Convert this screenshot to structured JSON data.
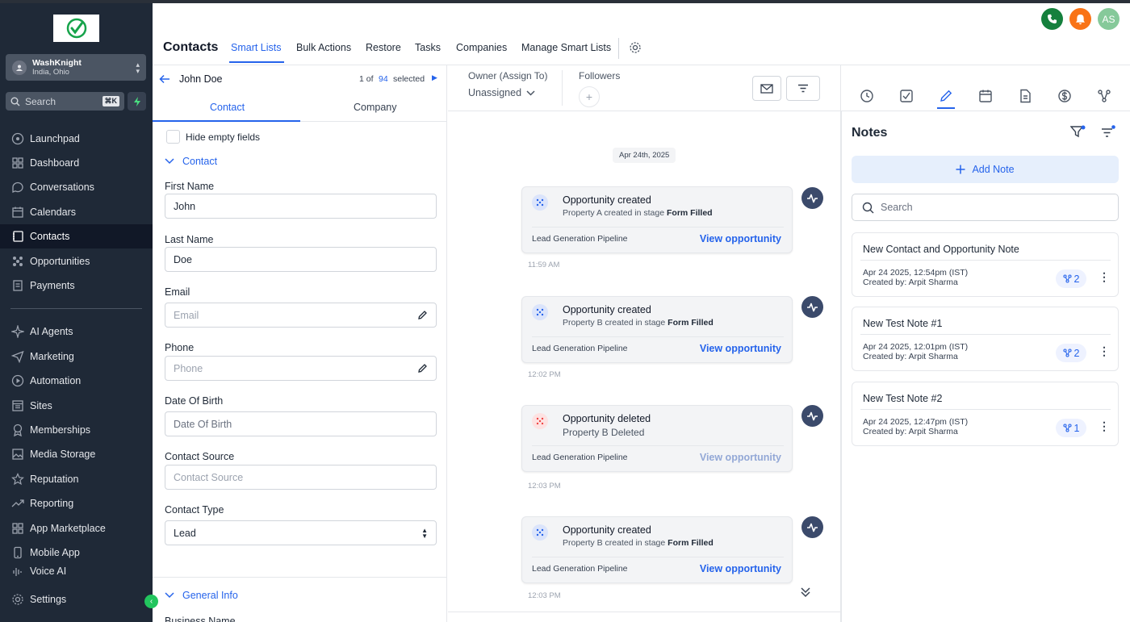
{
  "sidebar": {
    "account": {
      "name": "WashKnight",
      "location": "India, Ohio"
    },
    "search": {
      "placeholder": "Search",
      "shortcut": "⌘K"
    },
    "items": [
      {
        "label": "Launchpad"
      },
      {
        "label": "Dashboard"
      },
      {
        "label": "Conversations"
      },
      {
        "label": "Calendars"
      },
      {
        "label": "Contacts"
      },
      {
        "label": "Opportunities"
      },
      {
        "label": "Payments"
      },
      {
        "label": "AI Agents"
      },
      {
        "label": "Marketing"
      },
      {
        "label": "Automation"
      },
      {
        "label": "Sites"
      },
      {
        "label": "Memberships"
      },
      {
        "label": "Media Storage"
      },
      {
        "label": "Reputation"
      },
      {
        "label": "Reporting"
      },
      {
        "label": "App Marketplace"
      },
      {
        "label": "Mobile App"
      },
      {
        "label": "Voice AI"
      },
      {
        "label": "Settings"
      }
    ],
    "active_item": "Contacts"
  },
  "header": {
    "title": "Contacts",
    "tabs": [
      {
        "label": "Smart Lists"
      },
      {
        "label": "Bulk Actions"
      },
      {
        "label": "Restore"
      },
      {
        "label": "Tasks"
      },
      {
        "label": "Companies"
      },
      {
        "label": "Manage Smart Lists"
      }
    ],
    "active_tab": "Smart Lists",
    "user_initials": "AS"
  },
  "contact_panel": {
    "name": "John Doe",
    "pager": {
      "prefix": "1 of",
      "count": "94",
      "suffix": "selected"
    },
    "subtabs": [
      {
        "label": "Contact"
      },
      {
        "label": "Company"
      }
    ],
    "hide_empty_label": "Hide empty fields",
    "section_contact": "Contact",
    "fields": {
      "first_name": {
        "label": "First Name",
        "value": "John"
      },
      "last_name": {
        "label": "Last Name",
        "value": "Doe"
      },
      "email": {
        "label": "Email",
        "placeholder": "Email"
      },
      "phone": {
        "label": "Phone",
        "placeholder": "Phone"
      },
      "dob": {
        "label": "Date Of Birth",
        "placeholder": "Date Of Birth"
      },
      "source": {
        "label": "Contact Source",
        "placeholder": "Contact Source"
      },
      "type": {
        "label": "Contact Type",
        "value": "Lead"
      }
    },
    "section_general": "General Info",
    "business_name_label": "Business Name"
  },
  "activity": {
    "owner_label": "Owner (Assign To)",
    "owner_value": "Unassigned",
    "followers_label": "Followers",
    "date_chip": "Apr 24th, 2025",
    "cards": [
      {
        "title": "Opportunity created",
        "sub_pre": "Property A created in stage ",
        "sub_bold": "Form Filled",
        "pipeline": "Lead Generation Pipeline",
        "link": "View opportunity",
        "time": "11:59 AM",
        "kind": "created"
      },
      {
        "title": "Opportunity created",
        "sub_pre": "Property B created in stage ",
        "sub_bold": "Form Filled",
        "pipeline": "Lead Generation Pipeline",
        "link": "View opportunity",
        "time": "12:02 PM",
        "kind": "created"
      },
      {
        "title": "Opportunity deleted",
        "sub_pre": "Property B Deleted",
        "sub_bold": "",
        "pipeline": "Lead Generation Pipeline",
        "link": "View opportunity",
        "time": "12:03 PM",
        "kind": "deleted"
      },
      {
        "title": "Opportunity created",
        "sub_pre": "Property B created in stage ",
        "sub_bold": "Form Filled",
        "pipeline": "Lead Generation Pipeline",
        "link": "View opportunity",
        "time": "12:03 PM",
        "kind": "created"
      }
    ],
    "colors": {
      "link": "#2563eb",
      "created_icon": "#dbe4fb",
      "deleted_icon": "#fde2e2"
    }
  },
  "notes": {
    "title": "Notes",
    "add_label": "Add Note",
    "search_placeholder": "Search",
    "items": [
      {
        "title": "New Contact and Opportunity Note",
        "date": "Apr 24 2025, 12:54pm (IST)",
        "author": "Created by: Arpit Sharma",
        "count": "2"
      },
      {
        "title": "New Test Note #1",
        "date": "Apr 24 2025, 12:01pm (IST)",
        "author": "Created by: Arpit Sharma",
        "count": "2"
      },
      {
        "title": "New Test Note #2",
        "date": "Apr 24 2025, 12:47pm (IST)",
        "author": "Created by: Arpit Sharma",
        "count": "1"
      }
    ]
  }
}
